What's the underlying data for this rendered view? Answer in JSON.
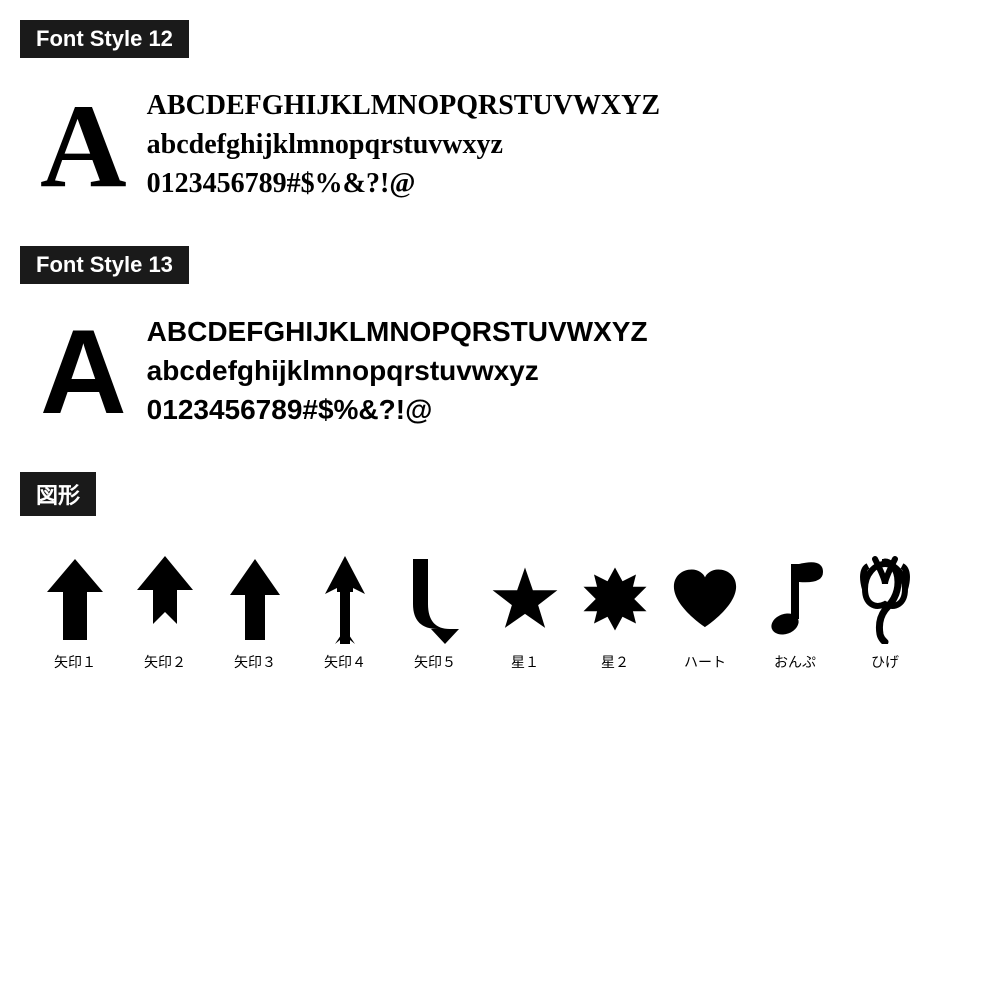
{
  "sections": [
    {
      "id": "font-style-12",
      "title": "Font Style 12",
      "big_letter": "A",
      "rows": [
        "ABCDEFGHIJKLMNOPQRSTUVWXYZ",
        "abcdefghijklmnopqrstuvwxyz",
        "0123456789#$%&?!@"
      ]
    },
    {
      "id": "font-style-13",
      "title": "Font Style 13",
      "big_letter": "A",
      "rows": [
        "ABCDEFGHIJKLMNOPQRSTUVWXYZ",
        "abcdefghijklmnopqrstuvwxyz",
        "0123456789#$%&?!@"
      ]
    }
  ],
  "shapes_section": {
    "title": "図形",
    "items": [
      {
        "id": "arrow1",
        "label": "矢印１"
      },
      {
        "id": "arrow2",
        "label": "矢印２"
      },
      {
        "id": "arrow3",
        "label": "矢印３"
      },
      {
        "id": "arrow4",
        "label": "矢印４"
      },
      {
        "id": "arrow5",
        "label": "矢印５"
      },
      {
        "id": "star1",
        "label": "星１"
      },
      {
        "id": "star2",
        "label": "星２"
      },
      {
        "id": "heart",
        "label": "ハート"
      },
      {
        "id": "music",
        "label": "おんぷ"
      },
      {
        "id": "hige",
        "label": "ひげ"
      }
    ]
  }
}
